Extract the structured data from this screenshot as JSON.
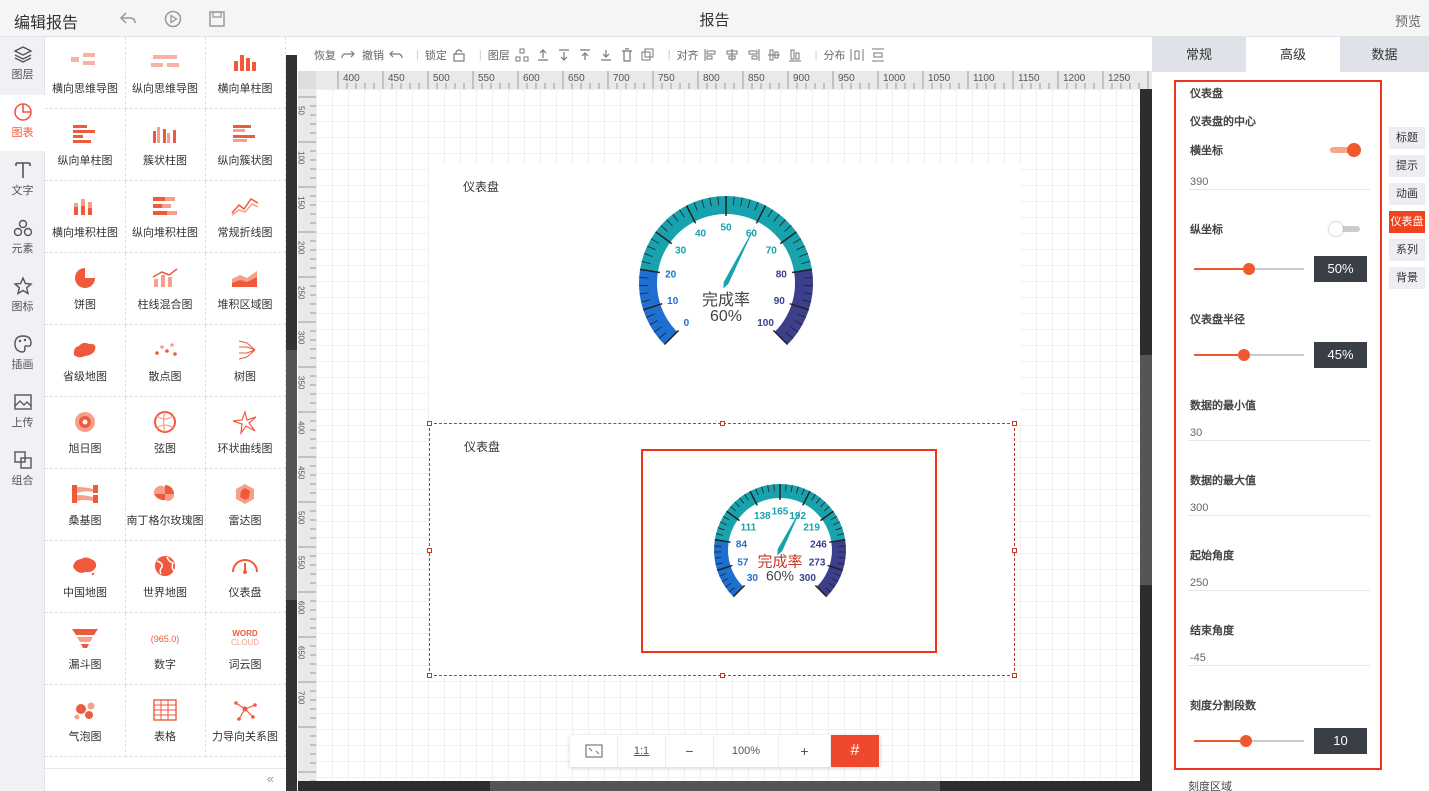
{
  "app": {
    "title": "编辑报告",
    "doc_title": "报告",
    "preview": "预览"
  },
  "iconbar": [
    {
      "label": "图层",
      "icon": "layers-icon"
    },
    {
      "label": "图表",
      "icon": "chart-icon"
    },
    {
      "label": "文字",
      "icon": "text-icon"
    },
    {
      "label": "元素",
      "icon": "elements-icon"
    },
    {
      "label": "图标",
      "icon": "star-icon"
    },
    {
      "label": "插画",
      "icon": "palette-icon"
    },
    {
      "label": "上传",
      "icon": "image-upload-icon"
    },
    {
      "label": "组合",
      "icon": "group-icon"
    }
  ],
  "chart_types": [
    "横向思维导图",
    "纵向思维导图",
    "横向单柱图",
    "纵向单柱图",
    "簇状柱图",
    "纵向簇状图",
    "横向堆积柱图",
    "纵向堆积柱图",
    "常规折线图",
    "饼图",
    "柱线混合图",
    "堆积区域图",
    "省级地图",
    "散点图",
    "树图",
    "旭日图",
    "弦图",
    "环状曲线图",
    "桑基图",
    "南丁格尔玫瑰图",
    "雷达图",
    "中国地图",
    "世界地图",
    "仪表盘",
    "漏斗图",
    "数字",
    "词云图",
    "气泡图",
    "表格",
    "力导向关系图"
  ],
  "toolbar": {
    "redo": "恢复",
    "undo": "撤销",
    "lock": "锁定",
    "layer": "图层",
    "align": "对齐",
    "distribute": "分布"
  },
  "ruler_ticks": [
    "400",
    "450",
    "500",
    "550",
    "600",
    "650",
    "700",
    "750",
    "800",
    "850",
    "900",
    "950",
    "1000",
    "1050",
    "1100",
    "1150",
    "1200",
    "1250"
  ],
  "vruler_ticks": [
    "50",
    "100",
    "150",
    "200",
    "250",
    "300",
    "350",
    "400",
    "450",
    "500",
    "550",
    "600",
    "650",
    "700"
  ],
  "gauge1": {
    "title": "仪表盘",
    "label": "完成率",
    "value_text": "60%",
    "ticks": [
      "0",
      "10",
      "20",
      "30",
      "40",
      "50",
      "60",
      "70",
      "80",
      "90",
      "100"
    ],
    "min": 0,
    "max": 100,
    "value": 60
  },
  "gauge2": {
    "title": "仪表盘",
    "label": "完成率",
    "value_text": "60%",
    "ticks": [
      "30",
      "57",
      "84",
      "111",
      "138",
      "165",
      "192",
      "219",
      "246",
      "273",
      "300"
    ],
    "min": 30,
    "max": 300,
    "value": 192
  },
  "zoom": {
    "ratio": "1:1",
    "minus": "−",
    "level": "100%",
    "plus": "+",
    "grid": "#"
  },
  "tabs": [
    "常规",
    "高级",
    "数据"
  ],
  "side_tabs": [
    "标题",
    "提示",
    "动画",
    "仪表盘",
    "系列",
    "背景"
  ],
  "props": {
    "section": "仪表盘",
    "center_heading": "仪表盘的中心",
    "x_label": "横坐标",
    "x_value": "390",
    "y_label": "纵坐标",
    "y_value": "50%",
    "y_level": 0.5,
    "radius_label": "仪表盘半径",
    "radius_value": "45%",
    "radius_level": 0.45,
    "min_label": "数据的最小值",
    "min_value": "30",
    "max_label": "数据的最大值",
    "max_value": "300",
    "start_label": "起始角度",
    "start_value": "250",
    "end_label": "结束角度",
    "end_value": "-45",
    "split_label": "刻度分割段数",
    "split_value": "10",
    "split_level": 0.47,
    "next_label": "刻度区域"
  },
  "colors": {
    "accent": "#f0482c",
    "gauge_low": "#1e6fd0",
    "gauge_mid": "#17a2ad",
    "gauge_high": "#3b3f8c"
  }
}
